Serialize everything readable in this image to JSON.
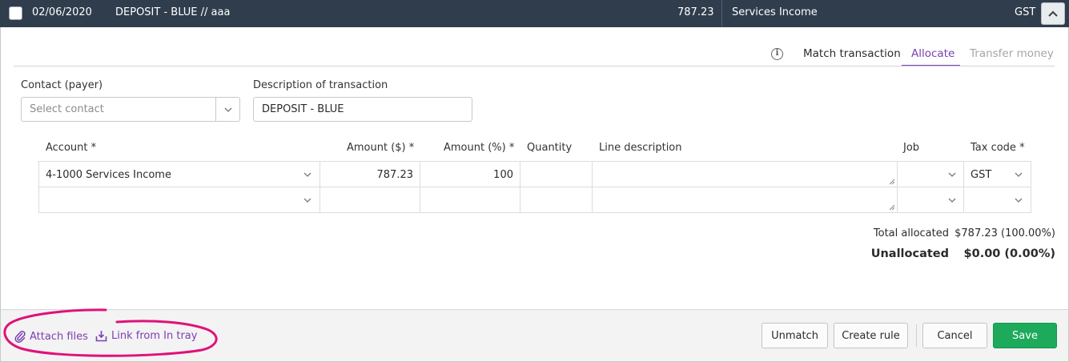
{
  "header": {
    "date": "02/06/2020",
    "description": "DEPOSIT - BLUE // aaa",
    "amount": "787.23",
    "account": "Services Income",
    "tax": "GST",
    "collapse_icon": "chevron-up-icon"
  },
  "tabs": {
    "info_icon": "info-icon",
    "match": "Match transaction",
    "allocate": "Allocate",
    "transfer": "Transfer money",
    "active": "Allocate"
  },
  "form": {
    "contact_label": "Contact (payer)",
    "contact_placeholder": "Select contact",
    "description_label": "Description of transaction",
    "description_value": "DEPOSIT - BLUE"
  },
  "table": {
    "headers": {
      "account": "Account *",
      "amount": "Amount ($) *",
      "percent": "Amount (%) *",
      "quantity": "Quantity",
      "line_description": "Line description",
      "job": "Job",
      "tax_code": "Tax code *"
    },
    "rows": [
      {
        "account": "4-1000 Services Income",
        "amount": "787.23",
        "percent": "100",
        "quantity": "",
        "line_description": "",
        "job": "",
        "tax_code": "GST"
      },
      {
        "account": "",
        "amount": "",
        "percent": "",
        "quantity": "",
        "line_description": "",
        "job": "",
        "tax_code": ""
      }
    ]
  },
  "totals": {
    "allocated_label": "Total allocated",
    "allocated_value": "$787.23 (100.00%)",
    "unallocated_label": "Unallocated",
    "unallocated_value": "$0.00 (0.00%)"
  },
  "footer": {
    "attach_files": "Attach files",
    "link_in_tray": "Link from In tray",
    "unmatch": "Unmatch",
    "create_rule": "Create rule",
    "cancel": "Cancel",
    "save": "Save"
  },
  "colors": {
    "header_bg": "#2f3d4d",
    "accent_purple": "#7b3fb3",
    "save_green": "#1daa5b",
    "highlight_pink": "#e0117a"
  }
}
